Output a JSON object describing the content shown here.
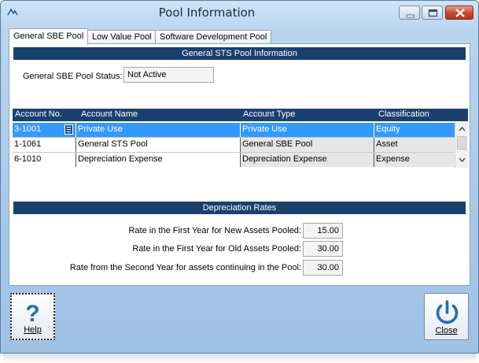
{
  "window": {
    "title": "Pool Information"
  },
  "tabs": [
    {
      "label": "General SBE Pool",
      "active": true
    },
    {
      "label": "Low Value Pool",
      "active": false
    },
    {
      "label": "Software Development Pool",
      "active": false
    }
  ],
  "pool_info": {
    "header": "General STS Pool Information",
    "status_label": "General SBE Pool Status:",
    "status_value": "Not Active"
  },
  "accounts_table": {
    "columns": [
      "Account No.",
      "Account Name",
      "Account Type",
      "Classification"
    ],
    "rows": [
      {
        "account_no": "3-1001",
        "account_name": "Private Use",
        "account_type": "Private Use",
        "classification": "Equity",
        "selected": true
      },
      {
        "account_no": "1-1061",
        "account_name": "General STS Pool",
        "account_type": "General SBE Pool",
        "classification": "Asset",
        "selected": false
      },
      {
        "account_no": "6-1010",
        "account_name": "Depreciation Expense",
        "account_type": "Depreciation Expense",
        "classification": "Expense",
        "selected": false
      }
    ]
  },
  "depreciation": {
    "header": "Depreciation Rates",
    "rates": [
      {
        "label": "Rate in the First Year for New Assets Pooled:",
        "value": "15.00"
      },
      {
        "label": "Rate in the First Year for Old Assets Pooled:",
        "value": "30.00"
      },
      {
        "label": "Rate from the Second Year for assets continuing in the Pool:",
        "value": "30.00"
      }
    ]
  },
  "buttons": {
    "help_label": "Help",
    "close_label": "Close"
  },
  "icons": {
    "help": "question-mark-icon",
    "close": "power-icon",
    "lookup": "list-lookup-icon"
  },
  "colors": {
    "header_bg": "#1b3f6e",
    "selection": "#3399ff",
    "icon_blue": "#1f6fb5"
  }
}
